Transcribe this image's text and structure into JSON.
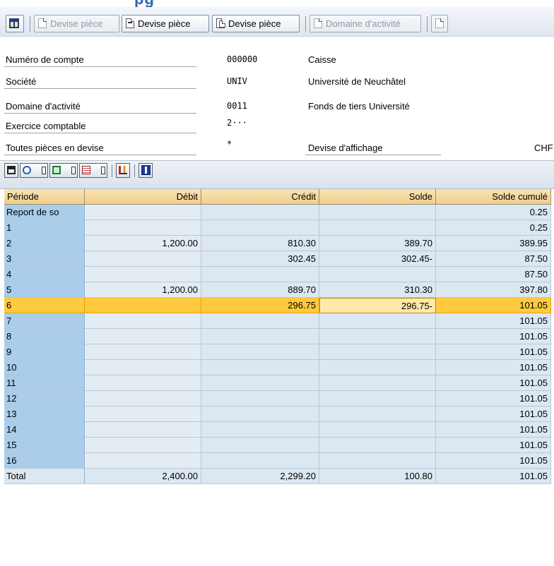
{
  "title_fragment": "pg",
  "toolbar": {
    "buttons": [
      {
        "label": "",
        "icon": "layout-icon",
        "enabled": true
      },
      {
        "label": "Devise pièce",
        "icon": "document-icon",
        "enabled": false
      },
      {
        "label": "Devise pièce",
        "icon": "document-export-icon",
        "enabled": true
      },
      {
        "label": "Devise pièce",
        "icon": "document-copy-icon",
        "enabled": true
      },
      {
        "label": "Domaine d'activité",
        "icon": "document-icon",
        "enabled": false
      }
    ]
  },
  "info": {
    "rows": [
      {
        "label": "Numéro de compte",
        "value": "000000",
        "description": "Caisse"
      },
      {
        "label": "Société",
        "value": "UNIV",
        "description": "Université de Neuchâtel"
      },
      {
        "label": "Domaine d'activité",
        "value": "0011",
        "description": "Fonds de tiers Université"
      },
      {
        "label": "Exercice comptable",
        "value": "2···",
        "description": ""
      },
      {
        "label": "Toutes pièces en devise",
        "value": "*",
        "label2": "Devise d'affichage",
        "value2": "CHF"
      }
    ]
  },
  "grid": {
    "columns": [
      "Période",
      "Débit",
      "Crédit",
      "Solde",
      "Solde cumulé"
    ],
    "rows": [
      {
        "periode": "Report de so",
        "debit": "",
        "credit": "",
        "solde": "",
        "cumule": "0.25"
      },
      {
        "periode": "1",
        "debit": "",
        "credit": "",
        "solde": "",
        "cumule": "0.25"
      },
      {
        "periode": "2",
        "debit": "1,200.00",
        "credit": "810.30",
        "solde": "389.70",
        "cumule": "389.95"
      },
      {
        "periode": "3",
        "debit": "",
        "credit": "302.45",
        "solde": "302.45-",
        "cumule": "87.50"
      },
      {
        "periode": "4",
        "debit": "",
        "credit": "",
        "solde": "",
        "cumule": "87.50"
      },
      {
        "periode": "5",
        "debit": "1,200.00",
        "credit": "889.70",
        "solde": "310.30",
        "cumule": "397.80"
      },
      {
        "periode": "6",
        "debit": "",
        "credit": "296.75",
        "solde": "296.75-",
        "cumule": "101.05"
      },
      {
        "periode": "7",
        "debit": "",
        "credit": "",
        "solde": "",
        "cumule": "101.05"
      },
      {
        "periode": "8",
        "debit": "",
        "credit": "",
        "solde": "",
        "cumule": "101.05"
      },
      {
        "periode": "9",
        "debit": "",
        "credit": "",
        "solde": "",
        "cumule": "101.05"
      },
      {
        "periode": "10",
        "debit": "",
        "credit": "",
        "solde": "",
        "cumule": "101.05"
      },
      {
        "periode": "11",
        "debit": "",
        "credit": "",
        "solde": "",
        "cumule": "101.05"
      },
      {
        "periode": "12",
        "debit": "",
        "credit": "",
        "solde": "",
        "cumule": "101.05"
      },
      {
        "periode": "13",
        "debit": "",
        "credit": "",
        "solde": "",
        "cumule": "101.05"
      },
      {
        "periode": "14",
        "debit": "",
        "credit": "",
        "solde": "",
        "cumule": "101.05"
      },
      {
        "periode": "15",
        "debit": "",
        "credit": "",
        "solde": "",
        "cumule": "101.05"
      },
      {
        "periode": "16",
        "debit": "",
        "credit": "",
        "solde": "",
        "cumule": "101.05"
      },
      {
        "periode": "Total",
        "debit": "2,400.00",
        "credit": "2,299.20",
        "solde": "100.80",
        "cumule": "101.05"
      }
    ]
  },
  "colors": {
    "selected_row": "#ffc940",
    "header": "#f0cf8b",
    "key_column": "#a9cdea",
    "cell": "#dbe7f1"
  }
}
